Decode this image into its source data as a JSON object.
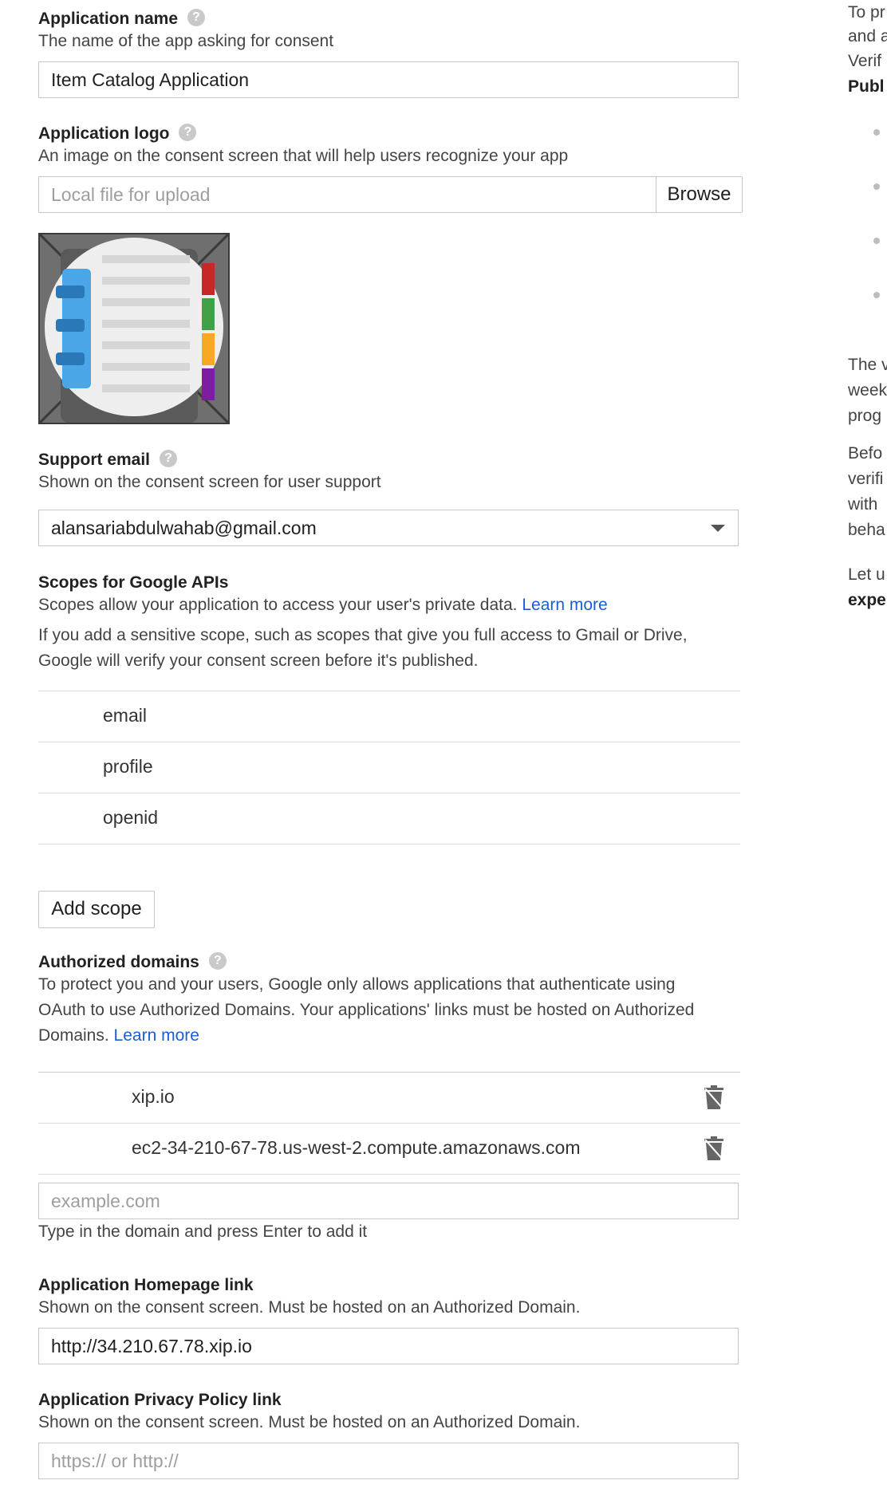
{
  "app_name": {
    "label": "Application name",
    "desc": "The name of the app asking for consent",
    "value": "Item Catalog Application"
  },
  "app_logo": {
    "label": "Application logo",
    "desc": "An image on the consent screen that will help users recognize your app",
    "placeholder": "Local file for upload",
    "browse_label": "Browse"
  },
  "support_email": {
    "label": "Support email",
    "desc": "Shown on the consent screen for user support",
    "value": "alansariabdulwahab@gmail.com"
  },
  "scopes": {
    "label": "Scopes for Google APIs",
    "desc": "Scopes allow your application to access your user's private data.",
    "learn_more": "Learn more",
    "note_line1": "If you add a sensitive scope, such as scopes that give you full access to Gmail or Drive,",
    "note_line2": "Google will verify your consent screen before it's published.",
    "items": [
      "email",
      "profile",
      "openid"
    ],
    "add_label": "Add scope"
  },
  "authorized_domains": {
    "label": "Authorized domains",
    "desc_line1": "To protect you and your users, Google only allows applications that authenticate using",
    "desc_line2": "OAuth to use Authorized Domains. Your applications' links must be hosted on Authorized",
    "desc_line3": "Domains.",
    "learn_more": "Learn more",
    "domains": [
      "xip.io",
      "ec2-34-210-67-78.us-west-2.compute.amazonaws.com"
    ],
    "placeholder": "example.com",
    "hint": "Type in the domain and press Enter to add it"
  },
  "homepage_link": {
    "label": "Application Homepage link",
    "desc": "Shown on the consent screen. Must be hosted on an Authorized Domain.",
    "value": "http://34.210.67.78.xip.io"
  },
  "privacy_link": {
    "label": "Application Privacy Policy link",
    "desc": "Shown on the consent screen. Must be hosted on an Authorized Domain.",
    "placeholder": "https:// or http://"
  },
  "side_panel": {
    "line1": "To pr",
    "line2": "and a",
    "line3": "Verif",
    "line4": "Publ",
    "para2_1": "The v",
    "para2_2": "week",
    "para2_3": "prog",
    "para3_1": "Befo",
    "para3_2": "verifi",
    "para3_3": "with",
    "para3_4": "beha",
    "link": "Let u",
    "bold": "expe"
  },
  "colors": {
    "link": "#1a5fd1",
    "border": "#c7c7c7"
  }
}
